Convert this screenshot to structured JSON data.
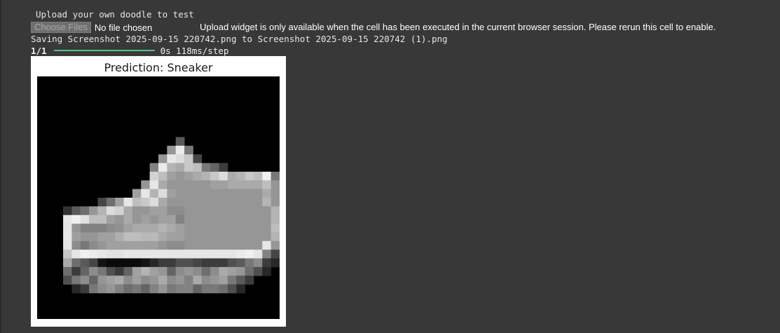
{
  "output": {
    "title_line": "Upload your own doodle to test",
    "upload": {
      "button_label": "Choose Files",
      "file_status": "No file chosen",
      "note": "Upload widget is only available when the cell has been executed in the current browser session. Please rerun this cell to enable."
    },
    "saving_line": "Saving Screenshot 2025-09-15 220742.png to Screenshot 2025-09-15 220742 (1).png",
    "progress": {
      "step": "1/1",
      "fraction": 1.0,
      "timing": "0s 118ms/step"
    },
    "figure": {
      "title": "Prediction: Sneaker"
    }
  },
  "colors": {
    "background": "#383838",
    "progress_fill": "#4fc48a"
  }
}
